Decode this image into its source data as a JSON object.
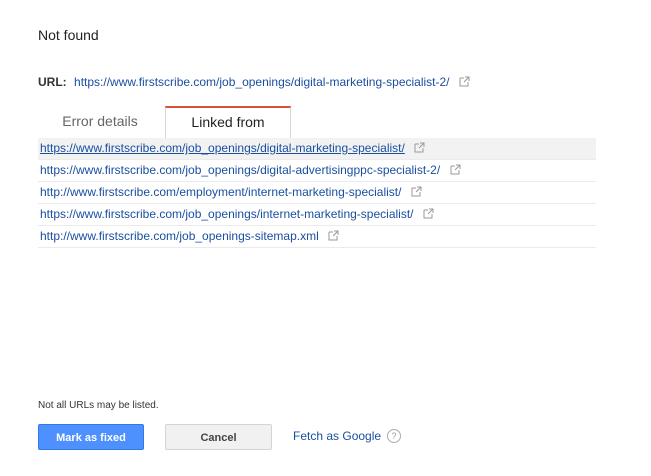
{
  "header": {
    "title": "Not found",
    "url_label": "URL:",
    "url": "https://www.firstscribe.com/job_openings/digital-marketing-specialist-2/"
  },
  "tabs": [
    {
      "label": "Error details",
      "active": false
    },
    {
      "label": "Linked from",
      "active": true
    }
  ],
  "linked_from": [
    "https://www.firstscribe.com/job_openings/digital-marketing-specialist/",
    "https://www.firstscribe.com/job_openings/digital-advertisingppc-specialist-2/",
    "http://www.firstscribe.com/employment/internet-marketing-specialist/",
    "https://www.firstscribe.com/job_openings/internet-marketing-specialist/",
    "http://www.firstscribe.com/job_openings-sitemap.xml"
  ],
  "footer": {
    "note": "Not all URLs may be listed.",
    "mark_fixed_label": "Mark as fixed",
    "cancel_label": "Cancel",
    "fetch_label": "Fetch as Google",
    "help_icon": "?"
  },
  "colors": {
    "link": "#1a4fa0",
    "active_tab_accent": "#dd4b39",
    "primary_button": "#4d90fe"
  },
  "icons": {
    "external_link": "external-link-icon",
    "help": "help-icon"
  }
}
